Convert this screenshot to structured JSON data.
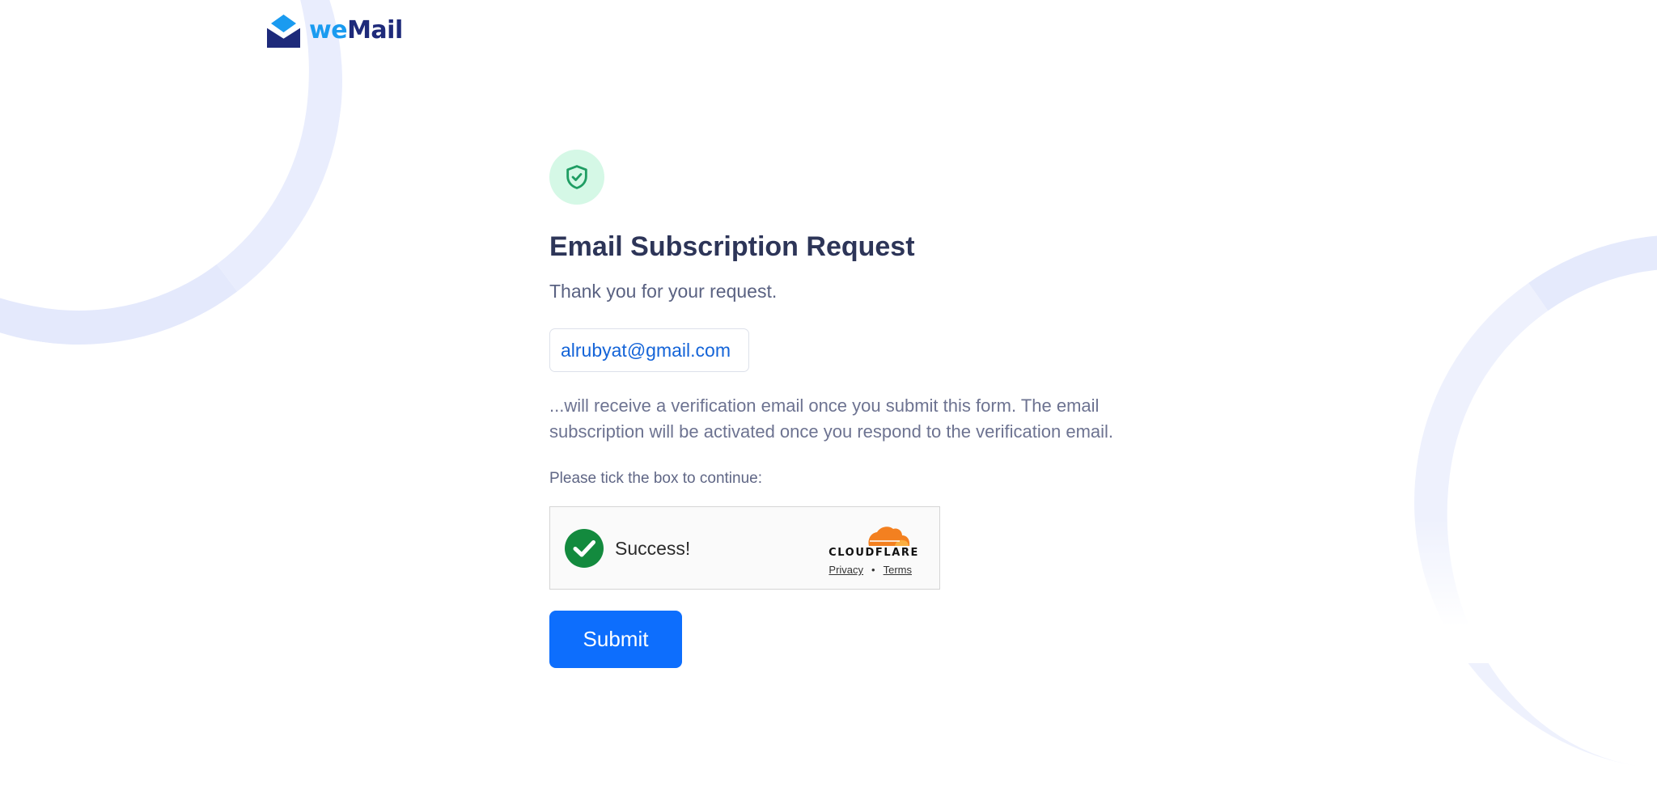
{
  "brand": {
    "name_part1": "we",
    "name_part2": "Mail",
    "colors": {
      "we": "#1a9bf0",
      "mail": "#1e2a7a",
      "envelope": "#1e2a7a",
      "envelope_flap": "#1a9bf0"
    }
  },
  "main": {
    "icon": "shield-check-icon",
    "title": "Email Subscription Request",
    "thanks": "Thank you for your request.",
    "email": "alrubyat@gmail.com",
    "note": "...will receive a verification email once you submit this form. The email subscription will be activated once you respond to the verification email.",
    "tick_prompt": "Please tick the box to continue:"
  },
  "captcha": {
    "status_icon": "success-check-icon",
    "status": "Success!",
    "provider": "CLOUDFLARE",
    "privacy_label": "Privacy",
    "separator": "•",
    "terms_label": "Terms"
  },
  "form": {
    "submit_label": "Submit"
  },
  "colors": {
    "primary_button": "#0d6efd",
    "title": "#2d3558",
    "email_link": "#1464d8",
    "shield_bg": "#d5f8e6",
    "shield_stroke": "#1f9d63",
    "success_green": "#138a3e",
    "cloudflare_orange": "#f38020"
  }
}
